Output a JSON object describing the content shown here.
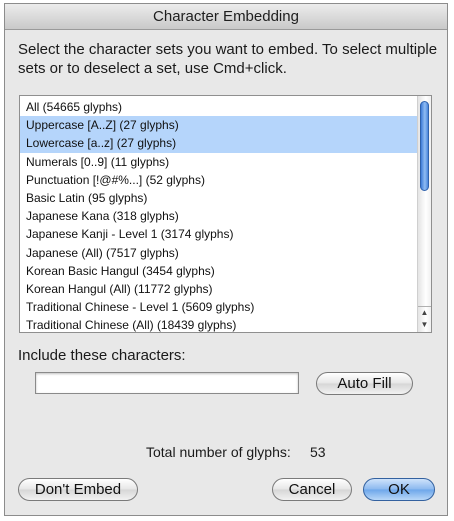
{
  "window": {
    "title": "Character Embedding"
  },
  "instructions": "Select the character sets you want to embed. To select multiple sets or to deselect a set, use Cmd+click.",
  "charsets": [
    {
      "label": "All  (54665 glyphs)",
      "selected": false
    },
    {
      "label": "Uppercase [A..Z]  (27 glyphs)",
      "selected": true
    },
    {
      "label": "Lowercase [a..z]  (27 glyphs)",
      "selected": true
    },
    {
      "label": "Numerals [0..9]  (11 glyphs)",
      "selected": false
    },
    {
      "label": "Punctuation [!@#%...]  (52 glyphs)",
      "selected": false
    },
    {
      "label": "Basic Latin  (95 glyphs)",
      "selected": false
    },
    {
      "label": "Japanese Kana  (318 glyphs)",
      "selected": false
    },
    {
      "label": "Japanese Kanji - Level 1 (3174 glyphs)",
      "selected": false
    },
    {
      "label": "Japanese (All)  (7517 glyphs)",
      "selected": false
    },
    {
      "label": "Korean Basic Hangul (3454 glyphs)",
      "selected": false
    },
    {
      "label": "Korean Hangul (All) (11772 glyphs)",
      "selected": false
    },
    {
      "label": "Traditional Chinese - Level 1 (5609 glyphs)",
      "selected": false
    },
    {
      "label": "Traditional Chinese (All)  (18439 glyphs)",
      "selected": false
    }
  ],
  "include": {
    "label": "Include these characters:",
    "value": "",
    "auto_fill": "Auto Fill"
  },
  "total": {
    "label": "Total number of glyphs:",
    "value": "53"
  },
  "buttons": {
    "dont_embed": "Don't Embed",
    "cancel": "Cancel",
    "ok": "OK"
  },
  "colors": {
    "selection": "#b5d5fb",
    "scroll_thumb": "#5a93e0",
    "default_button": "#7ab0ee"
  },
  "icons": {
    "scroll_up": "scroll-up-arrow-icon",
    "scroll_down": "scroll-down-arrow-icon"
  }
}
